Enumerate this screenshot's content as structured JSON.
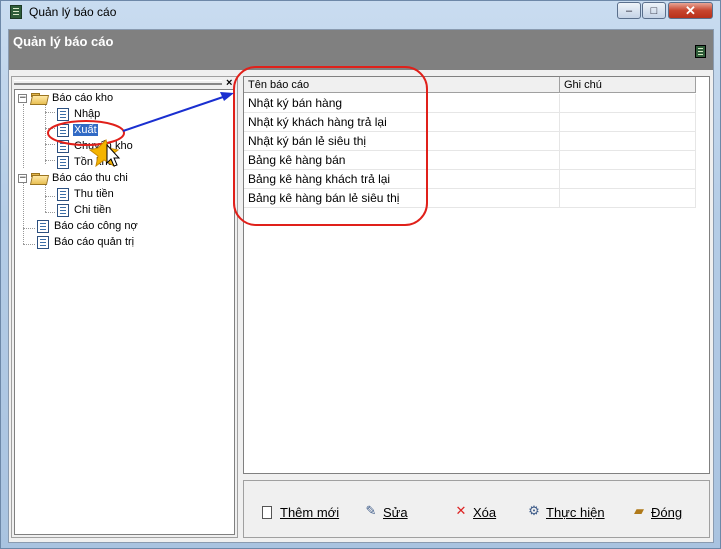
{
  "window": {
    "title": "Quản lý báo cáo",
    "controls": {
      "minimize": "–",
      "maximize": "□",
      "close": "✕"
    }
  },
  "header": {
    "title": "Quản lý báo cáo"
  },
  "tree": {
    "close_label": "×",
    "items": [
      {
        "label": "Báo cáo kho",
        "expander": "−"
      },
      {
        "label": "Nhập"
      },
      {
        "label": "Xuất"
      },
      {
        "label": "Chuyển kho"
      },
      {
        "label": "Tồn kho"
      },
      {
        "label": "Báo cáo thu chi",
        "expander": "−"
      },
      {
        "label": "Thu tiền"
      },
      {
        "label": "Chi tiền"
      },
      {
        "label": "Báo cáo công nợ"
      },
      {
        "label": "Báo cáo quản trị"
      }
    ]
  },
  "grid": {
    "columns": [
      "Tên báo cáo",
      "Ghi chú"
    ],
    "rows": [
      [
        "Nhật ký bán hàng",
        ""
      ],
      [
        "Nhật ký khách hàng trả lại",
        ""
      ],
      [
        "Nhật ký bán lẻ siêu thị",
        ""
      ],
      [
        "Bảng kê hàng bán",
        ""
      ],
      [
        "Bảng kê hàng khách trả lại",
        ""
      ],
      [
        "Bảng kê hàng bán lẻ siêu thị",
        ""
      ]
    ]
  },
  "toolbar": {
    "new_label": "Thêm mới",
    "edit_label": "Sửa",
    "delete_label": "Xóa",
    "run_label": "Thực hiện",
    "close_label": "Đóng"
  },
  "colors": {
    "header_bg": "#808080",
    "selection": "#316ac5",
    "annotation_red": "#e0201a",
    "annotation_arrow": "#1a2fd0"
  }
}
